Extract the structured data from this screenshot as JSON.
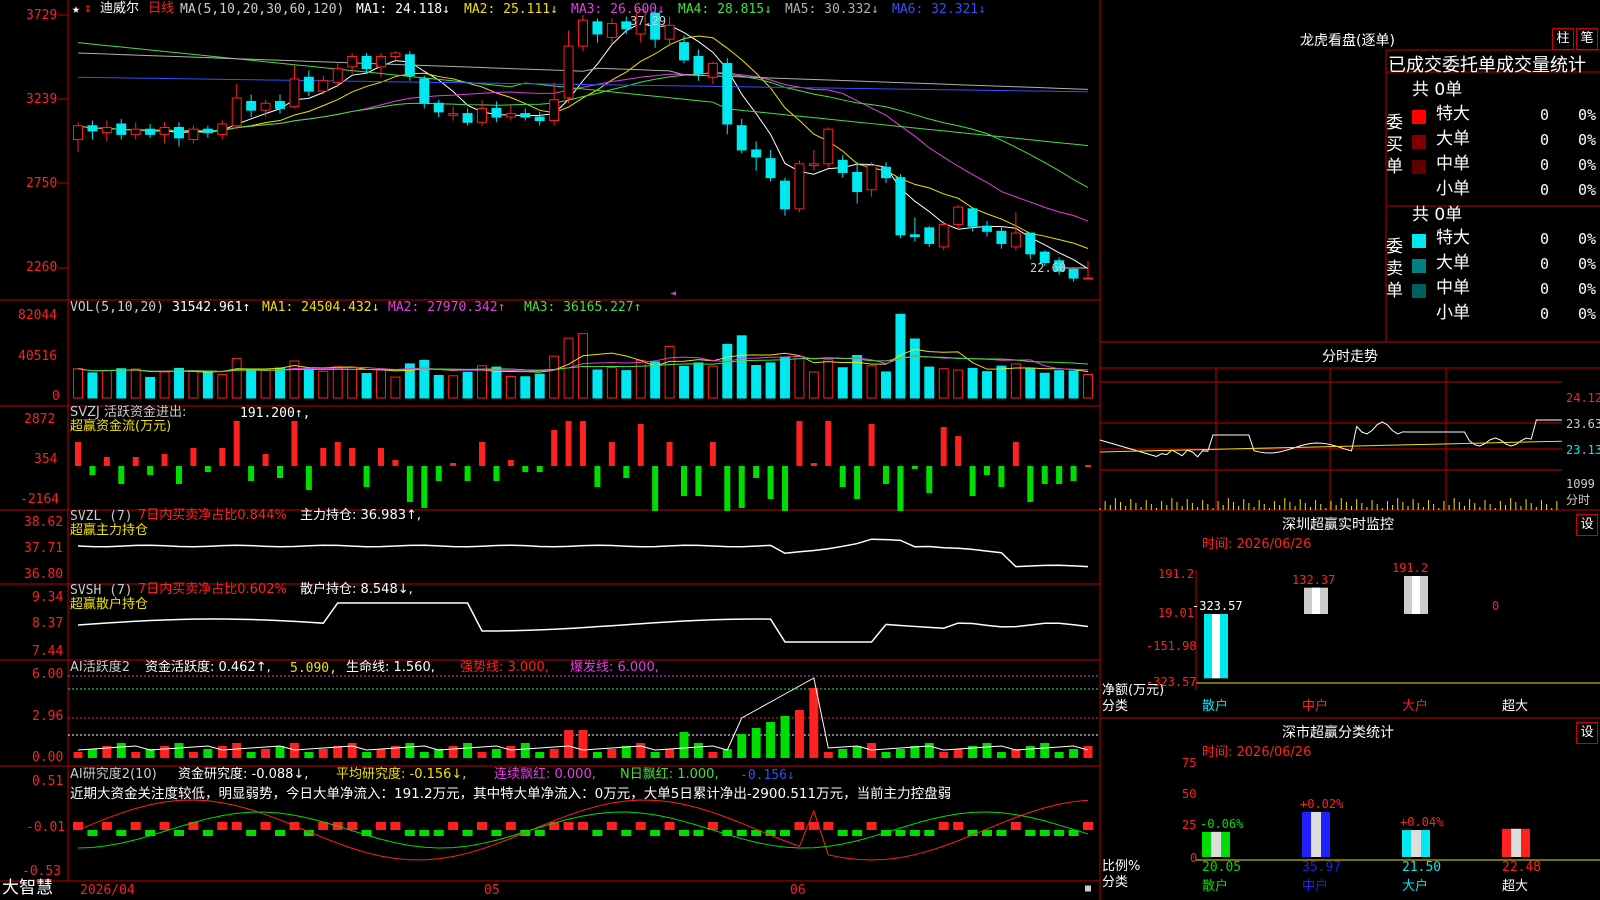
{
  "colors": {
    "up": "#ff2020",
    "down": "#00e8f0",
    "frame": "#c00000",
    "ma1": "#ffffff",
    "ma2": "#f0e000",
    "ma3": "#e040e0",
    "ma4": "#40e040",
    "ma5": "#b0b0b0",
    "ma6": "#3050ff",
    "green": "#00dd00",
    "red": "#ff2020"
  },
  "icons": {
    "star": "star-icon",
    "arrow": "arrow-icon",
    "lock": "lock-icon"
  },
  "main": {
    "star": "★",
    "stock_name": "迪威尔",
    "period": "日线",
    "ma_params": "MA(5,10,20,30,60,120)",
    "ma1": "MA1: 24.118↓",
    "ma2": "MA2: 25.111↓",
    "ma3": "MA3: 26.600↓",
    "ma4": "MA4: 28.815↓",
    "ma5": "MA5: 30.332↓",
    "ma6": "MA6: 32.321↓",
    "y_labels": [
      "3729",
      "3239",
      "2750",
      "2260"
    ],
    "high_label": "37.29",
    "low_label": "22.60"
  },
  "vol": {
    "title": "VOL(5,10,20)",
    "val": "31542.961↑",
    "ma1": "MA1: 24504.432↓",
    "ma2": "MA2: 27970.342↑",
    "ma3": "MA3: 36165.227↑",
    "y_labels": [
      "82044",
      "40516",
      "0"
    ]
  },
  "svzj": {
    "title": "SVZJ  活跃资金进出: ",
    "val": "191.200↑,",
    "sub": "超赢资金流(万元)",
    "y_labels": [
      "2872",
      "354",
      "-2164"
    ]
  },
  "svzl": {
    "title": "SVZL (7)",
    "t2": "7日内买卖净占比0.844%",
    "t3": "主力持仓: 36.983↑,",
    "sub": "超赢主力持仓",
    "y_labels": [
      "38.62",
      "37.71",
      "36.80"
    ]
  },
  "svsh": {
    "title": "SVSH (7)",
    "t2": "7日内买卖净占比0.602%",
    "t3": "散户持仓: 8.548↓,",
    "sub": "超赢散户持仓",
    "y_labels": [
      "9.34",
      "8.37",
      "7.44"
    ]
  },
  "ai1": {
    "title": "AI活跃度2",
    "t2": "资金活跃度: 0.462↑,",
    "t3": "5.090,",
    "t4": "生命线: 1.560,",
    "t5": "强势线: 3.000,",
    "t6": "爆发线: 6.000,",
    "y_labels": [
      "6.00",
      "2.96",
      "0.00"
    ]
  },
  "ai2": {
    "title": "AI研究度2(10)",
    "t2": "资金研究度: -0.088↓,",
    "t3": "平均研究度: -0.156↓,",
    "t4": "连续飘红: 0.000,",
    "t5": "N日飘红: 1.000,",
    "t6": "-0.156↓",
    "desc": "近期大资金关注度较低，明显弱势，今日大单净流入：191.2万元，其中特大单净流入：0万元，大单5日累计净出-2900.511万元，当前主力控盘弱",
    "y_labels": [
      "0.51",
      "-0.01",
      "-0.53"
    ]
  },
  "bottom": {
    "brand": "大智慧",
    "date1": "2026/04",
    "date2": "05",
    "date3": "06"
  },
  "right": {
    "lhb_title": "龙虎看盘(逐单)",
    "btn_col": "柱",
    "btn_bi": "笔",
    "stats_title": "已成交委托单成交量统计",
    "buy_label": "委买单",
    "sell_label": "委卖单",
    "buy_total": "共 0单",
    "sell_total": "共 0单",
    "buy_rows": [
      {
        "name": "特大",
        "v": "0",
        "p": "0%"
      },
      {
        "name": "大单",
        "v": "0",
        "p": "0%"
      },
      {
        "name": "中单",
        "v": "0",
        "p": "0%"
      },
      {
        "name": "小单",
        "v": "0",
        "p": "0%"
      }
    ],
    "sell_rows": [
      {
        "name": "特大",
        "v": "0",
        "p": "0%"
      },
      {
        "name": "大单",
        "v": "0",
        "p": "0%"
      },
      {
        "name": "中单",
        "v": "0",
        "p": "0%"
      },
      {
        "name": "小单",
        "v": "0",
        "p": "0%"
      }
    ],
    "fs_title": "分时走势",
    "fs_y": [
      "24.12",
      "23.63",
      "23.13"
    ],
    "fs_vol": "1099",
    "fs_vol_label": "分时",
    "mon_title": "深圳超赢实时监控",
    "mon_btn": "设",
    "mon_time": "时间: 2026/06/26",
    "mon_y": [
      "191.2",
      "19.01",
      "-151.98",
      "-323.57"
    ],
    "mon_unit": "净额(万元)",
    "mon_cat_label": "分类",
    "mon_bars": [
      {
        "cat": "散户",
        "val": -323.57,
        "label": "-323.57"
      },
      {
        "cat": "中户",
        "val": 132.37,
        "label": "132.37"
      },
      {
        "cat": "大户",
        "val": 191.2,
        "label": "191.2"
      },
      {
        "cat": "超大",
        "val": 0,
        "label": "0"
      }
    ],
    "cls_title": "深市超赢分类统计",
    "cls_btn": "设",
    "cls_time": "时间: 2026/06/26",
    "cls_y": [
      "75",
      "50",
      "25",
      "0"
    ],
    "cls_unit": "比例%",
    "cls_cat_label": "分类",
    "cls_bars": [
      {
        "cat": "散户",
        "val": 20.05,
        "label": "20.05",
        "chg": "-0.06%"
      },
      {
        "cat": "中户",
        "val": 35.97,
        "label": "35.97",
        "chg": "+0.02%"
      },
      {
        "cat": "大户",
        "val": 21.5,
        "label": "21.50",
        "chg": "+0.04%"
      },
      {
        "cat": "超大",
        "val": 22.48,
        "label": "22.48",
        "chg": ""
      }
    ]
  },
  "chart_data": {
    "type": "candlestick",
    "candles": [
      [
        30.2,
        31.0,
        29.5,
        31.2
      ],
      [
        31.0,
        30.7,
        30.2,
        31.3
      ],
      [
        30.6,
        30.9,
        30.1,
        31.3
      ],
      [
        31.1,
        30.5,
        30.2,
        31.4
      ],
      [
        30.5,
        30.8,
        30.2,
        31.2
      ],
      [
        30.8,
        30.5,
        30.3,
        31.1
      ],
      [
        30.5,
        30.9,
        30.0,
        31.2
      ],
      [
        30.9,
        30.3,
        29.8,
        31.2
      ],
      [
        30.2,
        30.8,
        30.0,
        31.0
      ],
      [
        30.8,
        30.6,
        30.3,
        31.0
      ],
      [
        30.5,
        31.1,
        30.2,
        31.3
      ],
      [
        31.0,
        32.6,
        30.8,
        33.4
      ],
      [
        32.4,
        31.9,
        31.5,
        32.8
      ],
      [
        31.9,
        32.3,
        31.5,
        32.5
      ],
      [
        32.4,
        32.0,
        31.7,
        32.8
      ],
      [
        32.1,
        33.7,
        32.0,
        34.5
      ],
      [
        33.8,
        33.0,
        32.7,
        34.2
      ],
      [
        33.0,
        33.6,
        32.8,
        33.9
      ],
      [
        33.5,
        34.3,
        33.2,
        34.6
      ],
      [
        34.4,
        35.0,
        34.0,
        35.2
      ],
      [
        35.0,
        34.3,
        34.0,
        35.2
      ],
      [
        34.4,
        35.0,
        33.8,
        35.2
      ],
      [
        35.0,
        35.2,
        34.8,
        35.3
      ],
      [
        35.1,
        33.9,
        33.6,
        35.3
      ],
      [
        33.7,
        32.3,
        32.0,
        33.9
      ],
      [
        32.3,
        31.8,
        31.5,
        32.5
      ],
      [
        31.6,
        31.7,
        31.3,
        32.1
      ],
      [
        31.7,
        31.2,
        31.0,
        32.0
      ],
      [
        31.2,
        32.0,
        31.0,
        32.5
      ],
      [
        32.0,
        31.5,
        31.2,
        32.4
      ],
      [
        31.5,
        31.7,
        31.3,
        32.2
      ],
      [
        31.7,
        31.5,
        31.3,
        32.0
      ],
      [
        31.5,
        31.3,
        31.0,
        31.8
      ],
      [
        31.3,
        32.5,
        31.0,
        33.5
      ],
      [
        32.6,
        35.6,
        32.3,
        36.5
      ],
      [
        35.6,
        37.1,
        35.3,
        37.4
      ],
      [
        37.0,
        36.3,
        35.8,
        37.2
      ],
      [
        36.1,
        36.9,
        35.7,
        37.2
      ],
      [
        37.0,
        36.6,
        36.3,
        37.3
      ],
      [
        36.3,
        37.7,
        35.8,
        37.7
      ],
      [
        37.5,
        36.0,
        35.5,
        37.9
      ],
      [
        36.0,
        36.8,
        35.6,
        37.3
      ],
      [
        35.8,
        34.8,
        34.6,
        36.2
      ],
      [
        35.0,
        34.0,
        33.6,
        35.4
      ],
      [
        33.8,
        34.6,
        33.4,
        34.7
      ],
      [
        34.6,
        31.1,
        30.5,
        34.9
      ],
      [
        31.0,
        29.6,
        29.4,
        31.4
      ],
      [
        29.6,
        29.2,
        28.4,
        30.1
      ],
      [
        29.1,
        28.0,
        27.8,
        29.6
      ],
      [
        27.8,
        26.2,
        25.8,
        28.0
      ],
      [
        26.2,
        28.8,
        26.0,
        29.0
      ],
      [
        28.7,
        28.8,
        28.4,
        29.6
      ],
      [
        28.8,
        30.8,
        28.6,
        30.9
      ],
      [
        29.0,
        28.3,
        28.0,
        29.3
      ],
      [
        28.3,
        27.2,
        26.5,
        28.9
      ],
      [
        27.3,
        28.7,
        26.9,
        28.9
      ],
      [
        28.6,
        28.0,
        27.7,
        28.9
      ],
      [
        28.0,
        24.7,
        24.5,
        28.2
      ],
      [
        24.7,
        24.6,
        24.3,
        25.7
      ],
      [
        25.1,
        24.2,
        24.0,
        25.2
      ],
      [
        24.0,
        25.3,
        23.8,
        25.5
      ],
      [
        25.3,
        26.3,
        25.0,
        26.4
      ],
      [
        26.2,
        25.2,
        24.9,
        26.3
      ],
      [
        25.2,
        24.9,
        24.6,
        25.5
      ],
      [
        24.9,
        24.2,
        23.9,
        25.2
      ],
      [
        24.0,
        24.8,
        23.8,
        26.0
      ],
      [
        24.8,
        23.6,
        23.3,
        24.8
      ],
      [
        23.7,
        23.1,
        22.9,
        23.8
      ],
      [
        23.2,
        22.6,
        22.4,
        23.4
      ],
      [
        22.7,
        22.2,
        22.0,
        22.8
      ],
      [
        22.2,
        22.2,
        22.1,
        23.2
      ]
    ],
    "ylim": [
      22.6,
      37.29
    ]
  }
}
